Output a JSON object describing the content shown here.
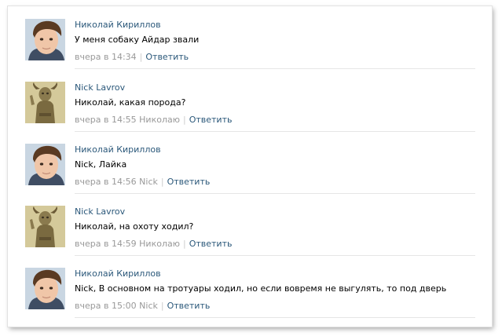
{
  "comments": [
    {
      "author": "Николай Кириллов",
      "text": "У меня собаку Айдар звали",
      "time": "вчера в 14:34",
      "reply_to": "",
      "reply_label": "Ответить",
      "avatar": "boy-avatar"
    },
    {
      "author": "Nick Lavrov",
      "text": "Николай, какая порода?",
      "time": "вчера в 14:55",
      "reply_to": "Николаю",
      "reply_label": "Ответить",
      "avatar": "horned-figure-avatar"
    },
    {
      "author": "Николай Кириллов",
      "text": "Nick, Лайка",
      "time": "вчера в 14:56",
      "reply_to": "Nick",
      "reply_label": "Ответить",
      "avatar": "boy-avatar"
    },
    {
      "author": "Nick Lavrov",
      "text": "Николай, на охоту ходил?",
      "time": "вчера в 14:59",
      "reply_to": "Николаю",
      "reply_label": "Ответить",
      "avatar": "horned-figure-avatar"
    },
    {
      "author": "Николай Кириллов",
      "text": "Nick, В основном на тротуары ходил, но если вовремя не выгулять, то под дверь",
      "time": "вчера в 15:00",
      "reply_to": "Nick",
      "reply_label": "Ответить",
      "avatar": "boy-avatar"
    }
  ],
  "colors": {
    "link": "#2b587a",
    "meta": "#999999",
    "text": "#000000",
    "divider": "#e6e6e6"
  }
}
